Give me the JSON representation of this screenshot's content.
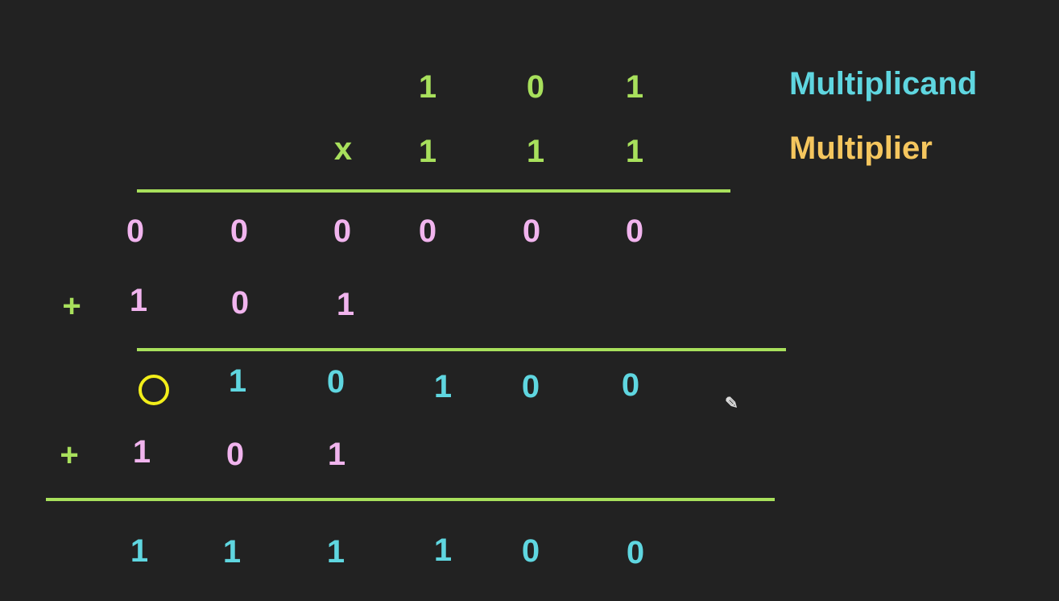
{
  "legend": {
    "multiplicand": "Multiplicand",
    "multiplier": "Multiplier",
    "colors": {
      "multiplicand": "#5fd6e0",
      "multiplier": "#f5c65e"
    }
  },
  "multiplicand": [
    "1",
    "0",
    "1"
  ],
  "times_sign": "x",
  "multiplier": [
    "1",
    "1",
    "1"
  ],
  "partial1": [
    "0",
    "0",
    "0",
    "0",
    "0",
    "0"
  ],
  "plus": "+",
  "shifted1": [
    "1",
    "0",
    "1"
  ],
  "sum1": [
    "1",
    "0",
    "1",
    "0",
    "0"
  ],
  "shifted2": [
    "1",
    "0",
    "1"
  ],
  "result": [
    "1",
    "1",
    "1",
    "1",
    "0",
    "0"
  ]
}
